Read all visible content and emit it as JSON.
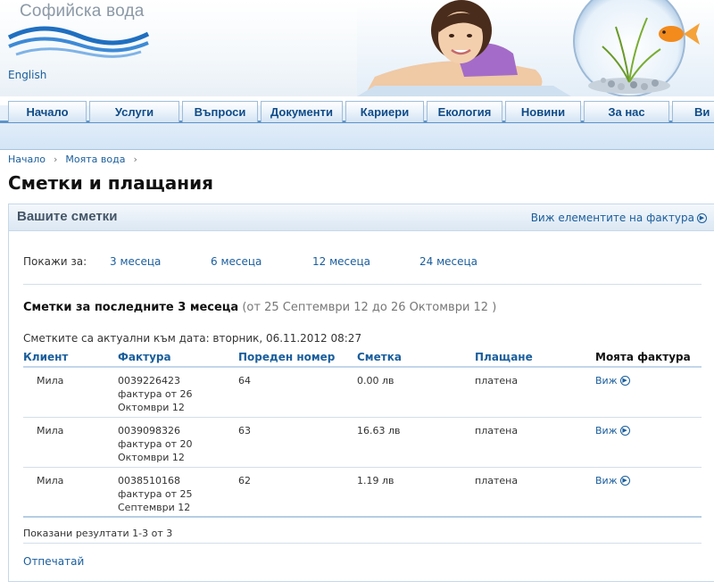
{
  "header": {
    "brand": "Софийска вода",
    "language_link": "English"
  },
  "nav": {
    "tabs": [
      {
        "label": "Начало"
      },
      {
        "label": "Услуги"
      },
      {
        "label": "Въпроси"
      },
      {
        "label": "Документи"
      },
      {
        "label": "Кариери"
      },
      {
        "label": "Екология"
      },
      {
        "label": "Новини"
      },
      {
        "label": "За нас"
      },
      {
        "label": "Ви"
      }
    ]
  },
  "breadcrumb": {
    "items": [
      "Начало",
      "Моята вода"
    ],
    "separator": "›"
  },
  "page_title": "Сметки и плащания",
  "panel": {
    "title": "Вашите сметки",
    "header_link": "Виж елементите на фактура",
    "filter_label": "Покажи за:",
    "filters": [
      "3 месеца",
      "6 месеца",
      "12 месеца",
      "24 месеца"
    ],
    "section_title": "Сметки за последните 3 месеца",
    "section_range": "(от 25 Септември 12 до 26 Октомври 12 )",
    "updated_text": "Сметките са актуални към дата: вторник, 06.11.2012 08:27",
    "columns": [
      "Клиент",
      "Фактура",
      "Пореден номер",
      "Сметка",
      "Плащане",
      "Моята фактура"
    ],
    "rows": [
      {
        "client": "Мила",
        "invoice_no": "0039226423",
        "invoice_line2": "фактура от 26",
        "invoice_line3": "Октомври 12",
        "seq": "64",
        "amount": "0.00 лв",
        "payment": "платена",
        "link": "Виж"
      },
      {
        "client": "Мила",
        "invoice_no": "0039098326",
        "invoice_line2": "фактура от 20",
        "invoice_line3": "Октомври 12",
        "seq": "63",
        "amount": "16.63 лв",
        "payment": "платена",
        "link": "Виж"
      },
      {
        "client": "Мила",
        "invoice_no": "0038510168",
        "invoice_line2": "фактура от 25",
        "invoice_line3": "Септември 12",
        "seq": "62",
        "amount": "1.19 лв",
        "payment": "платена",
        "link": "Виж"
      }
    ],
    "results_text": "Показани резултати 1-3 от 3",
    "print_link": "Отпечатай"
  },
  "colors": {
    "link": "#1a5e9c",
    "nav_text": "#0f4b87",
    "nav_line": "#5d93c8",
    "panel_border": "#c6d8ea"
  }
}
